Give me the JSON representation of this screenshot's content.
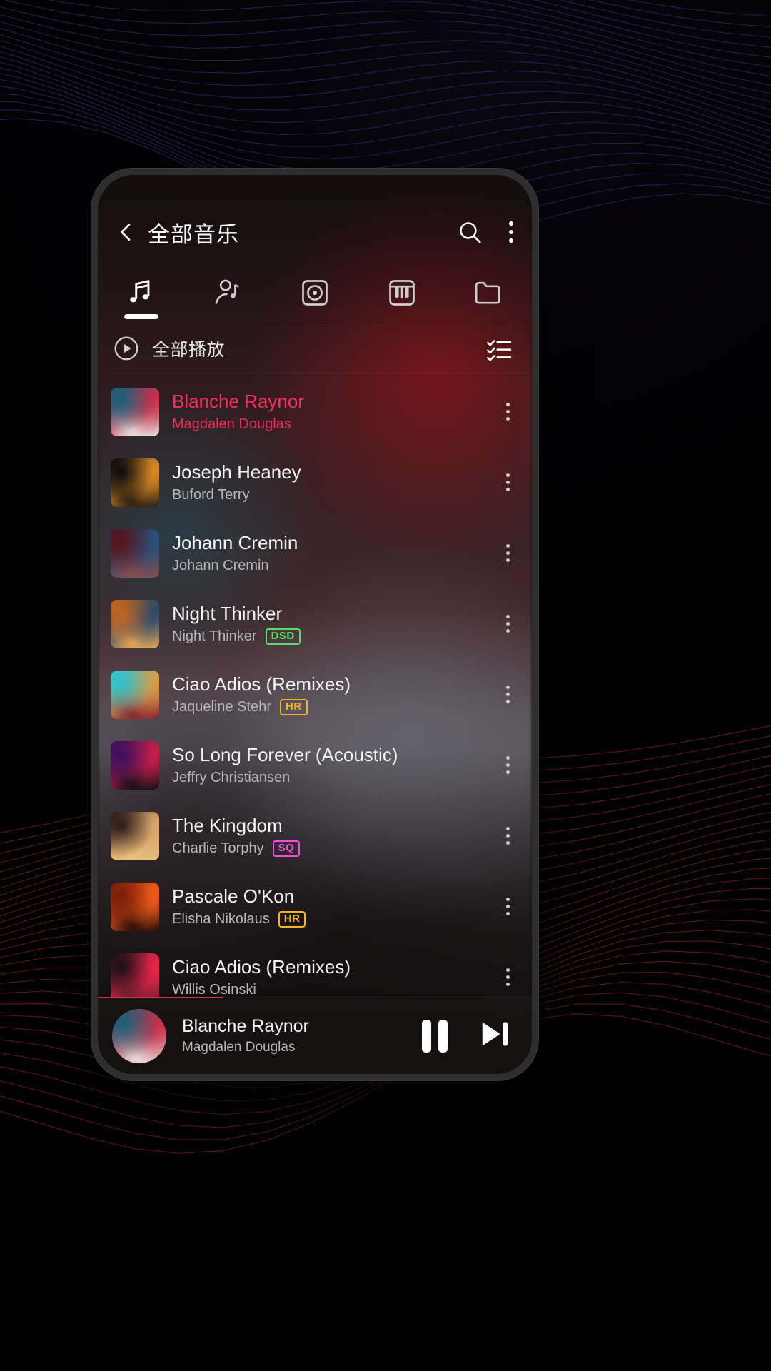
{
  "wallpaper": {
    "accent_purple": "#1d1b3a",
    "accent_red": "#3a1116"
  },
  "appbar": {
    "title": "全部音乐",
    "back_icon": "chevron-left-icon",
    "search_icon": "search-icon",
    "overflow_icon": "overflow-menu-icon"
  },
  "tabs": [
    {
      "name": "songs",
      "icon": "music-note-icon",
      "active": true
    },
    {
      "name": "artists",
      "icon": "artist-icon",
      "active": false
    },
    {
      "name": "albums",
      "icon": "album-disc-icon",
      "active": false
    },
    {
      "name": "genres",
      "icon": "piano-keys-icon",
      "active": false
    },
    {
      "name": "folders",
      "icon": "folder-icon",
      "active": false
    }
  ],
  "playall": {
    "label": "全部播放",
    "play_icon": "play-circle-icon",
    "multiselect_icon": "checklist-icon"
  },
  "songs": [
    {
      "title": "Blanche Raynor",
      "artist": "Magdalen Douglas",
      "badge": "",
      "playing": true,
      "art": {
        "c1": "#1b5f77",
        "c2": "#c9304a",
        "c3": "#e8e2e0"
      }
    },
    {
      "title": "Joseph Heaney",
      "artist": "Buford Terry",
      "badge": "",
      "playing": false,
      "art": {
        "c1": "#0c0b0b",
        "c2": "#d98a26",
        "c3": "#2a1c10"
      }
    },
    {
      "title": "Johann Cremin",
      "artist": "Johann Cremin",
      "badge": "",
      "playing": false,
      "art": {
        "c1": "#57131c",
        "c2": "#2a4f7a",
        "c3": "#8a4b4b"
      }
    },
    {
      "title": "Night Thinker",
      "artist": "Night Thinker",
      "badge": "DSD",
      "playing": false,
      "art": {
        "c1": "#c2631f",
        "c2": "#2e4b66",
        "c3": "#e8a85a"
      }
    },
    {
      "title": "Ciao Adios (Remixes)",
      "artist": "Jaqueline Stehr",
      "badge": "HR",
      "playing": false,
      "art": {
        "c1": "#2fc3cf",
        "c2": "#d89a4a",
        "c3": "#8a2230"
      }
    },
    {
      "title": "So Long Forever (Acoustic)",
      "artist": "Jeffry Christiansen",
      "badge": "",
      "playing": false,
      "art": {
        "c1": "#3a1060",
        "c2": "#c51f4a",
        "c3": "#141018"
      }
    },
    {
      "title": "The Kingdom",
      "artist": "Charlie Torphy",
      "badge": "SQ",
      "playing": false,
      "art": {
        "c1": "#2b1a18",
        "c2": "#d8a36c",
        "c3": "#e8c27d"
      }
    },
    {
      "title": "Pascale O'Kon",
      "artist": "Elisha Nikolaus",
      "badge": "HR",
      "playing": false,
      "art": {
        "c1": "#7a1c0a",
        "c2": "#f05a18",
        "c3": "#2a0f08"
      }
    },
    {
      "title": "Ciao Adios (Remixes)",
      "artist": "Willis Osinski",
      "badge": "",
      "playing": false,
      "art": {
        "c1": "#1a1016",
        "c2": "#e8244a",
        "c3": "#6b2030"
      }
    }
  ],
  "row_menu_icon": "overflow-menu-icon",
  "player": {
    "title": "Blanche Raynor",
    "artist": "Magdalen Douglas",
    "pause_icon": "pause-icon",
    "next_icon": "skip-next-icon",
    "progress_percent": 29,
    "avatar": {
      "c1": "#1b5f77",
      "c2": "#c9304a",
      "c3": "#e8e2e0"
    },
    "progress_color": "#cf2f3e"
  }
}
